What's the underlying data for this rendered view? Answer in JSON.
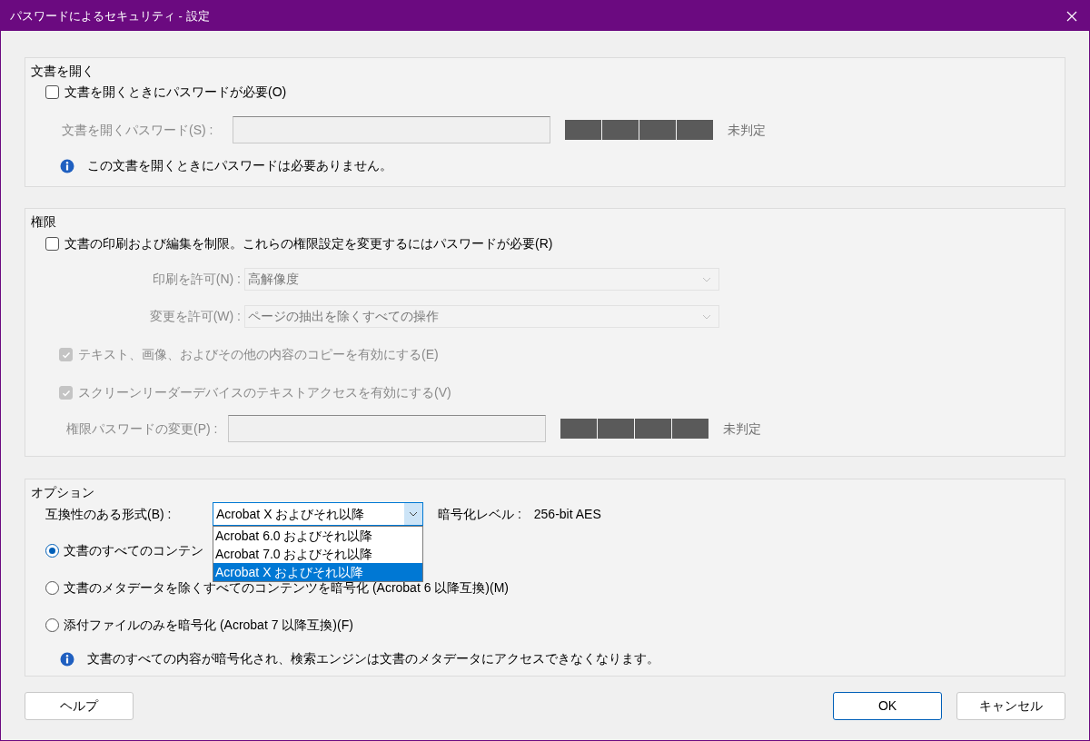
{
  "window": {
    "title": "パスワードによるセキュリティ - 設定"
  },
  "open_section": {
    "title": "文書を開く",
    "require_checkbox": {
      "label": "文書を開くときにパスワードが必要(O)",
      "checked": false
    },
    "password": {
      "label": "文書を開くパスワード(S) :",
      "disabled": true,
      "strength": "未判定"
    },
    "info": "この文書を開くときにパスワードは必要ありません。"
  },
  "permissions_section": {
    "title": "権限",
    "restrict_checkbox": {
      "label": "文書の印刷および編集を制限。これらの権限設定を変更するにはパスワードが必要(R)",
      "checked": false
    },
    "selects": [
      {
        "label": "印刷を許可(N) :",
        "value": "高解像度",
        "disabled": true
      },
      {
        "label": "変更を許可(W) :",
        "value": "ページの抽出を除くすべての操作",
        "disabled": true
      }
    ],
    "checkboxes": [
      {
        "label": "テキスト、画像、およびその他の内容のコピーを有効にする(E)",
        "checked": true,
        "disabled": true
      },
      {
        "label": "スクリーンリーダーデバイスのテキストアクセスを有効にする(V)",
        "checked": true,
        "disabled": true
      }
    ],
    "password": {
      "label": "権限パスワードの変更(P) :",
      "disabled": true,
      "strength": "未判定"
    }
  },
  "options_section": {
    "title": "オプション",
    "compat": {
      "label": "互換性のある形式(B) :",
      "value": "Acrobat X およびそれ以降",
      "expanded": true,
      "options": [
        {
          "label": "Acrobat 6.0 およびそれ以降",
          "selected": false
        },
        {
          "label": "Acrobat 7.0 およびそれ以降",
          "selected": false
        },
        {
          "label": "Acrobat X およびそれ以降",
          "selected": true
        }
      ]
    },
    "encryption": {
      "label": "暗号化レベル :",
      "value": "256-bit AES"
    },
    "radios": [
      {
        "label": "文書のすべてのコンテン",
        "selected": true
      },
      {
        "label": "文書のメタデータを除くすべてのコンテンツを暗号化 (Acrobat 6 以降互換)(M)",
        "selected": false
      },
      {
        "label": "添付ファイルのみを暗号化 (Acrobat 7 以降互換)(F)",
        "selected": false
      }
    ],
    "info": "文書のすべての内容が暗号化され、検索エンジンは文書のメタデータにアクセスできなくなります。"
  },
  "buttons": [
    {
      "label": "ヘルプ",
      "kind": "help"
    },
    {
      "label": "OK",
      "kind": "default"
    },
    {
      "label": "キャンセル",
      "kind": "cancel"
    }
  ]
}
